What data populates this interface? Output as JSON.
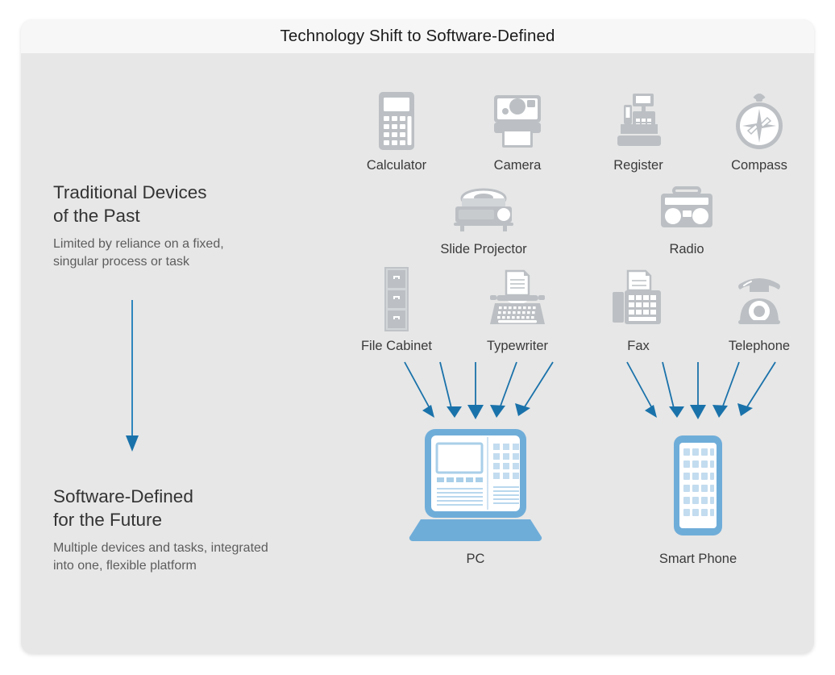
{
  "header": {
    "title": "Technology Shift to Software-Defined"
  },
  "colors": {
    "card_bg": "#e7e7e7",
    "header_bg": "#f7f7f7",
    "icon_gray": "#bcc0c4",
    "icon_gray_light": "#d2d5d8",
    "arrow_blue": "#1a72aa",
    "device_blue": "#6fadd9",
    "device_blue_light": "#c3dcef",
    "heading_text": "#333333",
    "body_text": "#5d5d5d",
    "label_text": "#3a3a3a"
  },
  "sections": {
    "past": {
      "heading": "Traditional Devices\nof the Past",
      "subtitle": "Limited by reliance on a fixed,\nsingular process or task"
    },
    "future": {
      "heading": "Software-Defined\nfor the Future",
      "subtitle": "Multiple devices and tasks, integrated\ninto one, flexible platform"
    }
  },
  "legacy_devices": [
    {
      "label": "Calculator",
      "icon": "calculator-icon",
      "row": 1
    },
    {
      "label": "Camera",
      "icon": "camera-icon",
      "row": 1
    },
    {
      "label": "Register",
      "icon": "cash-register-icon",
      "row": 1
    },
    {
      "label": "Compass",
      "icon": "compass-icon",
      "row": 1
    },
    {
      "label": "Slide Projector",
      "icon": "slide-projector-icon",
      "row": 2
    },
    {
      "label": "Radio",
      "icon": "radio-icon",
      "row": 2
    },
    {
      "label": "File Cabinet",
      "icon": "file-cabinet-icon",
      "row": 3
    },
    {
      "label": "Typewriter",
      "icon": "typewriter-icon",
      "row": 3
    },
    {
      "label": "Fax",
      "icon": "fax-icon",
      "row": 3
    },
    {
      "label": "Telephone",
      "icon": "telephone-icon",
      "row": 3
    }
  ],
  "modern_devices": [
    {
      "label": "PC",
      "icon": "laptop-icon"
    },
    {
      "label": "Smart Phone",
      "icon": "smartphone-icon"
    }
  ],
  "arrows": {
    "transition_arrow": "down-arrow-icon",
    "converging_to_pc": 5,
    "converging_to_phone": 5
  }
}
